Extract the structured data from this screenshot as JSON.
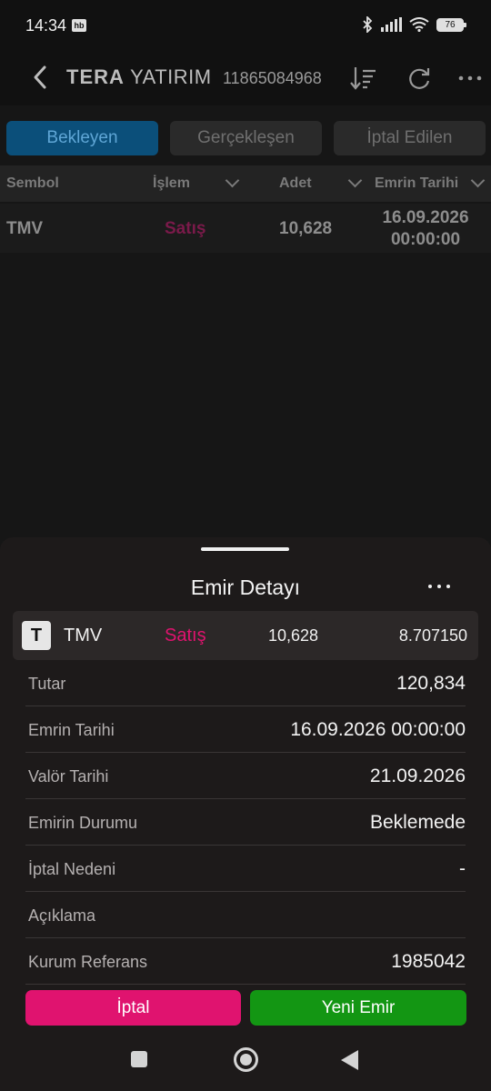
{
  "status": {
    "time": "14:34",
    "badge": "hb",
    "battery": "76"
  },
  "header": {
    "brand_bold": "TERA",
    "brand_rest": "YATIRIM",
    "account": "11865084968"
  },
  "tabs": [
    {
      "label": "Bekleyen",
      "active": true
    },
    {
      "label": "Gerçekleşen",
      "active": false
    },
    {
      "label": "İptal Edilen",
      "active": false
    }
  ],
  "table": {
    "headers": {
      "symbol": "Sembol",
      "side": "İşlem",
      "qty": "Adet",
      "date": "Emrin Tarihi"
    },
    "rows": [
      {
        "symbol": "TMV",
        "side": "Satış",
        "qty": "10,628",
        "date_line1": "16.09.2026",
        "date_line2": "00:00:00"
      }
    ]
  },
  "sheet": {
    "title": "Emir Detayı",
    "summary": {
      "badge": "T",
      "symbol": "TMV",
      "side": "Satış",
      "qty": "10,628",
      "price": "8.707150"
    },
    "details": [
      {
        "label": "Tutar",
        "value": "120,834"
      },
      {
        "label": "Emrin Tarihi",
        "value": "16.09.2026 00:00:00"
      },
      {
        "label": "Valör Tarihi",
        "value": "21.09.2026"
      },
      {
        "label": "Emirin Durumu",
        "value": "Beklemede"
      },
      {
        "label": "İptal Nedeni",
        "value": "-"
      },
      {
        "label": "Açıklama",
        "value": ""
      },
      {
        "label": "Kurum Referans",
        "value": "1985042"
      }
    ],
    "buttons": {
      "cancel": "İptal",
      "new_order": "Yeni Emir"
    }
  },
  "colors": {
    "accent_tab": "#0b4f7a",
    "sell": "#e0136f",
    "cancel_button": "#e0136f",
    "new_button": "#139613"
  }
}
